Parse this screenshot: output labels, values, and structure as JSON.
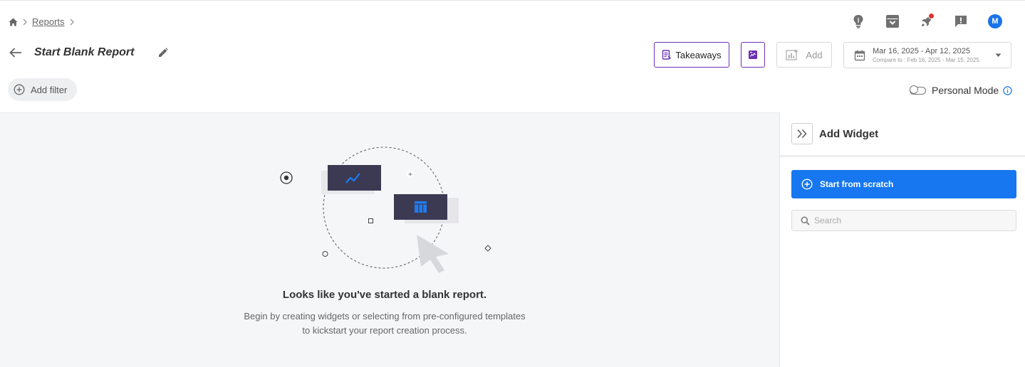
{
  "breadcrumb": {
    "reports": "Reports"
  },
  "header": {
    "title": "Start Blank Report",
    "takeaways_label": "Takeaways",
    "add_label": "Add",
    "avatar_initial": "M",
    "date_range": "Mar 16, 2025 - Apr 12, 2025",
    "compare_range": "Compare to : Feb 16, 2025 - Mar 15, 2025"
  },
  "filters": {
    "add_filter_label": "Add filter"
  },
  "personal_mode": {
    "label": "Personal Mode",
    "enabled": false
  },
  "empty_state": {
    "title": "Looks like you've started a blank report.",
    "line1": "Begin by creating widgets or selecting from pre-configured templates",
    "line2": "to kickstart your report creation process."
  },
  "side_panel": {
    "title": "Add Widget",
    "start_label": "Start from scratch",
    "search_placeholder": "Search"
  },
  "colors": {
    "primary": "#1677f0",
    "purple_border": "#6b2fb3",
    "canvas_bg": "#f5f6f8",
    "illustration_card": "#3b3a52",
    "notification": "#e03131"
  },
  "icons": [
    "home-icon",
    "chevron-right-icon",
    "lightbulb-icon",
    "archive-icon",
    "rocket-icon",
    "feedback-icon",
    "back-arrow-icon",
    "pencil-icon",
    "takeaways-icon",
    "chart-add-icon",
    "calendar-icon",
    "caret-down-icon",
    "plus-circle-icon",
    "info-icon",
    "double-chevron-icon",
    "search-icon"
  ]
}
